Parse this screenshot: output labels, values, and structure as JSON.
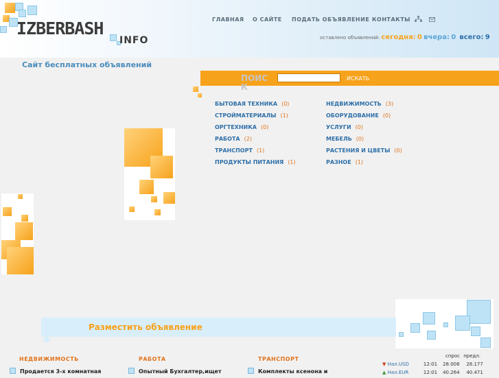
{
  "header": {
    "logo_main": "IZBERBASH",
    "logo_info": "INFO",
    "nav": [
      {
        "label": "ГЛАВНАЯ"
      },
      {
        "label": "О САЙТЕ"
      },
      {
        "label": "ПОДАТЬ ОБЪЯВЛЕНИЕ"
      },
      {
        "label": "КОНТАКТЫ"
      }
    ],
    "icons": [
      "sitemap-icon",
      "mail-icon"
    ],
    "stats": {
      "label": "оставлено объявлений:",
      "today_label": "сегодня:",
      "today": "0",
      "yesterday_label": "вчера:",
      "yesterday": "0",
      "total_label": "всего:",
      "total": "9"
    }
  },
  "tagline": "Сайт бесплатных объявлений",
  "search": {
    "label": "ПОИСК",
    "placeholder": "",
    "button": "ИСКАТЬ"
  },
  "categories": {
    "left": [
      {
        "name": "БЫТОВАЯ ТЕХНИКА",
        "count": "(0)"
      },
      {
        "name": "СТРОЙМАТЕРИАЛЫ",
        "count": "(1)"
      },
      {
        "name": "ОРГТЕХНИКА",
        "count": "(0)"
      },
      {
        "name": "РАБОТА",
        "count": "(2)"
      },
      {
        "name": "ТРАНСПОРТ",
        "count": "(1)"
      },
      {
        "name": "ПРОДУКТЫ ПИТАНИЯ",
        "count": "(1)"
      }
    ],
    "right": [
      {
        "name": "НЕДВИЖИМОСТЬ",
        "count": "(3)"
      },
      {
        "name": "ОБОРУДОВАНИЕ",
        "count": "(0)"
      },
      {
        "name": "УСЛУГИ",
        "count": "(0)"
      },
      {
        "name": "МЕБЕЛЬ",
        "count": "(0)"
      },
      {
        "name": "РАСТЕНИЯ И ЦВЕТЫ",
        "count": "(0)"
      },
      {
        "name": "РАЗНОЕ",
        "count": "(1)"
      }
    ]
  },
  "place_ad": "Разместить объявление",
  "recent": [
    {
      "heading": "НЕДВИЖИМОСТЬ",
      "item": "Продается 3-х комнатная"
    },
    {
      "heading": "РАБОТА",
      "item": "Опытный Бухгалтер,ищет"
    },
    {
      "heading": "ТРАНСПОРТ",
      "item": "Комплекты ксенона и"
    }
  ],
  "rates": {
    "col_buy": "спрос",
    "col_sell": "предл.",
    "rows": [
      {
        "name": "Нал.USD",
        "time": "12:01",
        "buy": "28.008",
        "sell": "28.177",
        "trend": "down"
      },
      {
        "name": "Нал.EUR",
        "time": "12:01",
        "buy": "40.264",
        "sell": "40.471",
        "trend": "up"
      }
    ]
  },
  "colors": {
    "accent_orange": "#f7a21b",
    "link_blue": "#2e6fa8",
    "count_orange": "#e0731b",
    "header_blue": "#cfe6f6"
  }
}
